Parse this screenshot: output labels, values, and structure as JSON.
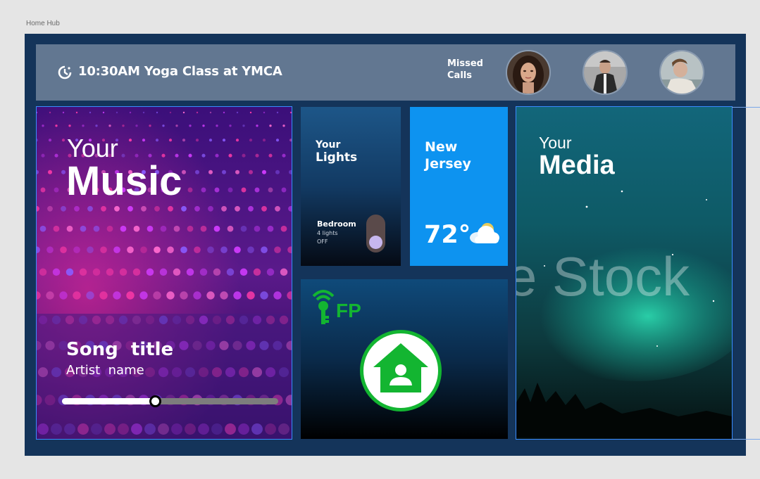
{
  "frame_label": "Home Hub",
  "reminder": {
    "icon": "clock-alert-icon",
    "text": "10:30AM Yoga Class at YMCA"
  },
  "missed_calls": {
    "label_line1": "Missed",
    "label_line2": "Calls",
    "avatars": [
      {
        "icon": "avatar-woman"
      },
      {
        "icon": "avatar-man-coat"
      },
      {
        "icon": "avatar-man-lying"
      }
    ]
  },
  "music": {
    "label_small": "Your",
    "label_big": "Music",
    "song_title": "Song  title",
    "artist": "Artist  name",
    "progress": 0.43
  },
  "lights": {
    "label_small": "Your",
    "label_big": "Lights",
    "room": "Bedroom",
    "count": "4 lights",
    "state": "OFF"
  },
  "weather": {
    "city_line1": "New",
    "city_line2": "Jersey",
    "temperature": "72°",
    "icon": "cloud-sun-icon"
  },
  "fp": {
    "logo": "FP",
    "icon": "home-user-icon"
  },
  "media": {
    "label_small": "Your",
    "label_big": "Media",
    "watermark": "e Stock"
  },
  "colors": {
    "frame_bg": "#14345a",
    "topbar_bg": "#627791",
    "weather_bg": "#0d93f0",
    "fp_green": "#13b531",
    "lights_toggle_knob": "#c7b7ee"
  }
}
